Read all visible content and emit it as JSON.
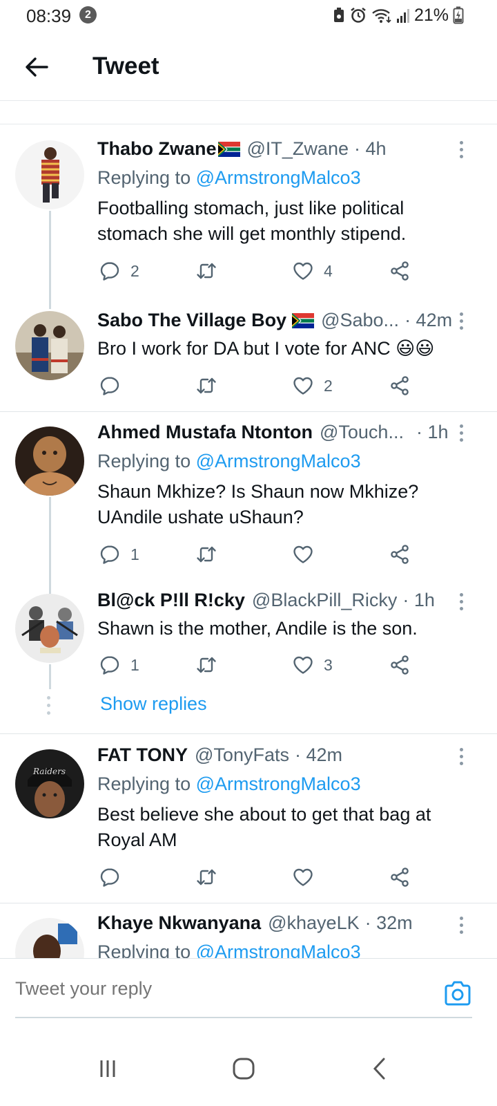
{
  "status_bar": {
    "time": "08:39",
    "notification_count": "2",
    "battery": "21%"
  },
  "header": {
    "title": "Tweet"
  },
  "colors": {
    "accent": "#1d9bf0",
    "secondary_text": "#536471"
  },
  "tweets": [
    {
      "name": "Thabo Zwane",
      "handle": "@IT_Zwane",
      "time": "· 4h",
      "replying_label": "Replying to",
      "replying_to": "@ArmstrongMalco3",
      "text": "Footballing stomach, just like political stomach she will get monthly stipend.",
      "replies": "2",
      "retweets": "",
      "likes": "4"
    },
    {
      "name": "Sabo The Village Boy",
      "handle": "@Sabo...",
      "time": "· 42m",
      "text": "Bro I work for DA but I vote for ANC 😃😃",
      "replies": "",
      "retweets": "",
      "likes": "2"
    },
    {
      "name": "Ahmed Mustafa Ntonton",
      "handle": "@Touch...",
      "time": "· 1h",
      "replying_label": "Replying to",
      "replying_to": "@ArmstrongMalco3",
      "text": "Shaun Mkhize? Is Shaun now Mkhize? UAndile ushate uShaun?",
      "replies": "1",
      "retweets": "",
      "likes": ""
    },
    {
      "name": "Bl@ck P!ll R!cky",
      "handle": "@BlackPill_Ricky",
      "time": "· 1h",
      "text": "Shawn is the mother, Andile is the son.",
      "replies": "1",
      "retweets": "",
      "likes": "3"
    },
    {
      "name": "FAT TONY",
      "handle": "@TonyFats",
      "time": "· 42m",
      "replying_label": "Replying to",
      "replying_to": "@ArmstrongMalco3",
      "text": "Best believe she about to get that bag at Royal AM",
      "replies": "",
      "retweets": "",
      "likes": ""
    },
    {
      "name": "Khaye Nkwanyana",
      "handle": "@khayeLK",
      "time": "· 32m",
      "replying_label": "Replying to",
      "replying_to": "@ArmstrongMalco3"
    }
  ],
  "show_replies": "Show replies",
  "composer": {
    "placeholder": "Tweet your reply"
  }
}
